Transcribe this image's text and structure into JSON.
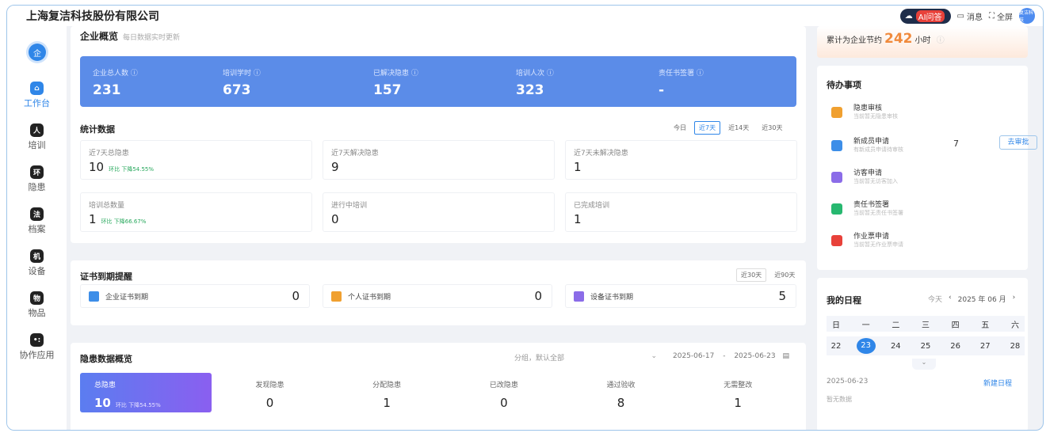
{
  "header": {
    "company": "上海复洁科技股份有限公司",
    "ai_label": "AI问答",
    "messages": "消息",
    "fullscreen": "全屏",
    "avatar_text": "复洁科技"
  },
  "sidebar": {
    "logo": "企",
    "items": [
      {
        "label": "工作台",
        "icon_char": "⌂",
        "icon": "home-icon"
      },
      {
        "label": "培训",
        "icon_char": "人",
        "icon": "person-icon"
      },
      {
        "label": "隐患",
        "icon_char": "环",
        "icon": "hazard-icon"
      },
      {
        "label": "档案",
        "icon_char": "法",
        "icon": "archive-icon"
      },
      {
        "label": "设备",
        "icon_char": "机",
        "icon": "device-icon"
      },
      {
        "label": "物品",
        "icon_char": "物",
        "icon": "goods-icon"
      },
      {
        "label": "协作应用",
        "icon_char": "•:",
        "icon": "apps-icon"
      }
    ]
  },
  "overview": {
    "title": "企业概览",
    "subtitle": "每日数据实时更新",
    "stats": [
      {
        "label": "企业总人数 ⓘ",
        "value": "231"
      },
      {
        "label": "培训学时 ⓘ",
        "value": "673"
      },
      {
        "label": "已解决隐患 ⓘ",
        "value": "157"
      },
      {
        "label": "培训人次 ⓘ",
        "value": "323"
      },
      {
        "label": "责任书签署 ⓘ",
        "value": "-"
      }
    ]
  },
  "statistics": {
    "title": "统计数据",
    "ranges": [
      "今日",
      "近7天",
      "近14天",
      "近30天"
    ],
    "cells": [
      {
        "label": "近7天总隐患",
        "value": "10",
        "delta": "环比 下降54.55%"
      },
      {
        "label": "近7天解决隐患",
        "value": "9",
        "delta": ""
      },
      {
        "label": "近7天未解决隐患",
        "value": "1",
        "delta": ""
      },
      {
        "label": "培训总数量",
        "value": "1",
        "delta": "环比 下降66.67%"
      },
      {
        "label": "进行中培训",
        "value": "0",
        "delta": ""
      },
      {
        "label": "已完成培训",
        "value": "1",
        "delta": ""
      }
    ]
  },
  "certs": {
    "title": "证书到期提醒",
    "ranges": [
      "近30天",
      "近90天"
    ],
    "items": [
      {
        "label": "企业证书到期",
        "value": "0",
        "color": "#3d8ee8"
      },
      {
        "label": "个人证书到期",
        "value": "0",
        "color": "#f0a030"
      },
      {
        "label": "设备证书到期",
        "value": "5",
        "color": "#8b6ce8"
      }
    ]
  },
  "hazard": {
    "title": "隐患数据概览",
    "filter": "分组，默认全部",
    "date_from": "2025-06-17",
    "date_sep": "-",
    "date_to": "2025-06-23",
    "items": [
      {
        "label": "总隐患",
        "value": "10",
        "delta": "环比 下降54.55%"
      },
      {
        "label": "发现隐患",
        "value": "0"
      },
      {
        "label": "分配隐患",
        "value": "1"
      },
      {
        "label": "已改隐患",
        "value": "0"
      },
      {
        "label": "通过验收",
        "value": "8"
      },
      {
        "label": "无需整改",
        "value": "1"
      }
    ]
  },
  "savings": {
    "prefix": "累计为企业节约",
    "value": "242",
    "suffix": "小时"
  },
  "todo": {
    "title": "待办事项",
    "items": [
      {
        "label": "隐患审核",
        "sub": "当前暂无隐患审核",
        "color": "#f0a030"
      },
      {
        "label": "新成员申请",
        "sub": "有新成员申请待审核",
        "color": "#3d8ee8",
        "count": "7",
        "action": "去审批"
      },
      {
        "label": "访客申请",
        "sub": "当前暂无访客加入",
        "color": "#8b6ce8"
      },
      {
        "label": "责任书签署",
        "sub": "当前暂无责任书签署",
        "color": "#27b870"
      },
      {
        "label": "作业票申请",
        "sub": "当前暂无作业票申请",
        "color": "#e8413a"
      }
    ]
  },
  "schedule": {
    "title": "我的日程",
    "today": "今天",
    "month": "2025 年 06 月",
    "weekdays": [
      "日",
      "一",
      "二",
      "三",
      "四",
      "五",
      "六"
    ],
    "days": [
      "22",
      "23",
      "24",
      "25",
      "26",
      "27",
      "28"
    ],
    "selected_date": "2025-06-23",
    "new_label": "新建日程",
    "empty": "暂无数据"
  }
}
